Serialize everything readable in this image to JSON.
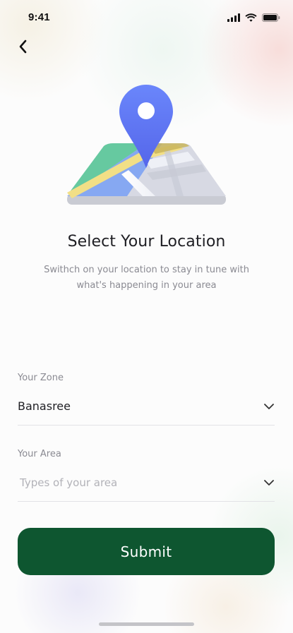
{
  "status_bar": {
    "time": "9:41",
    "icons": [
      "cellular-signal-icon",
      "wifi-icon",
      "battery-icon"
    ]
  },
  "navigation": {
    "back_icon": "chevron-left-icon"
  },
  "illustration": {
    "icon": "map-location-pin-illustration",
    "colors": {
      "pin": "#5f78f6",
      "map_green": "#66c9a0",
      "map_yellow": "#f3e08a",
      "map_blue": "#86a8f2",
      "map_gray": "#d4d6e0"
    }
  },
  "header": {
    "title": "Select Your Location",
    "subtitle": "Swithch on your location to stay in tune with what's happening in your area"
  },
  "form": {
    "zone": {
      "label": "Your Zone",
      "value": "Banasree",
      "icon": "chevron-down-icon"
    },
    "area": {
      "label": "Your Area",
      "placeholder": "Types of your area",
      "icon": "chevron-down-icon"
    }
  },
  "actions": {
    "submit_label": "Submit",
    "submit_color": "#0e5630"
  }
}
